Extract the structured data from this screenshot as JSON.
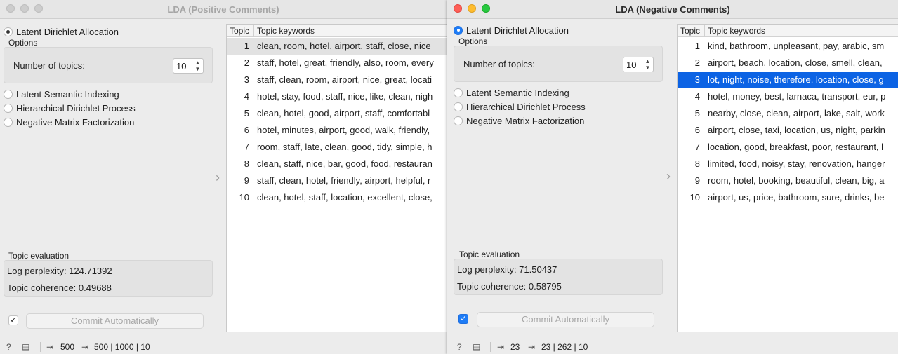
{
  "left": {
    "title": "LDA (Positive Comments)",
    "methods": {
      "lda": "Latent Dirichlet Allocation",
      "lsi": "Latent Semantic Indexing",
      "hdp": "Hierarchical Dirichlet Process",
      "nmf": "Negative Matrix Factorization"
    },
    "options_label": "Options",
    "num_topics_label": "Number of topics:",
    "num_topics_value": "10",
    "evaluation_label": "Topic evaluation",
    "log_perplexity": "Log perplexity: 124.71392",
    "topic_coherence": "Topic coherence: 0.49688",
    "commit_label": "Commit Automatically",
    "table": {
      "col_topic": "Topic",
      "col_keywords": "Topic keywords",
      "rows": [
        {
          "n": "1",
          "kw": "clean, room, hotel, airport, staff, close, nice"
        },
        {
          "n": "2",
          "kw": "staff, hotel, great, friendly, also, room, every"
        },
        {
          "n": "3",
          "kw": "staff, clean, room, airport, nice, great, locati"
        },
        {
          "n": "4",
          "kw": "hotel, stay, food, staff, nice, like, clean, nigh"
        },
        {
          "n": "5",
          "kw": "clean, hotel, good, airport, staff, comfortabl"
        },
        {
          "n": "6",
          "kw": "hotel, minutes, airport, good, walk, friendly,"
        },
        {
          "n": "7",
          "kw": "room, staff, late, clean, good, tidy, simple, h"
        },
        {
          "n": "8",
          "kw": "clean, staff, nice, bar, good, food, restauran"
        },
        {
          "n": "9",
          "kw": "staff, clean, hotel, friendly, airport, helpful, r"
        },
        {
          "n": "10",
          "kw": "clean, hotel, staff, location, excellent, close,"
        }
      ]
    },
    "status": {
      "input_count": "500",
      "output_summary": "500 | 1000 | 10"
    }
  },
  "right": {
    "title": "LDA (Negative Comments)",
    "methods": {
      "lda": "Latent Dirichlet Allocation",
      "lsi": "Latent Semantic Indexing",
      "hdp": "Hierarchical Dirichlet Process",
      "nmf": "Negative Matrix Factorization"
    },
    "options_label": "Options",
    "num_topics_label": "Number of topics:",
    "num_topics_value": "10",
    "evaluation_label": "Topic evaluation",
    "log_perplexity": "Log perplexity: 71.50437",
    "topic_coherence": "Topic coherence: 0.58795",
    "commit_label": "Commit Automatically",
    "table": {
      "col_topic": "Topic",
      "col_keywords": "Topic keywords",
      "rows": [
        {
          "n": "1",
          "kw": "kind, bathroom, unpleasant, pay, arabic, sm"
        },
        {
          "n": "2",
          "kw": "airport, beach, location, close, smell, clean,"
        },
        {
          "n": "3",
          "kw": "lot, night, noise, therefore, location, close, g"
        },
        {
          "n": "4",
          "kw": "hotel, money, best, larnaca, transport, eur, p"
        },
        {
          "n": "5",
          "kw": "nearby, close, clean, airport, lake, salt, work"
        },
        {
          "n": "6",
          "kw": "airport, close, taxi, location, us, night, parkin"
        },
        {
          "n": "7",
          "kw": "location, good, breakfast, poor, restaurant, l"
        },
        {
          "n": "8",
          "kw": "limited, food, noisy, stay, renovation, hanger"
        },
        {
          "n": "9",
          "kw": "room, hotel, booking, beautiful, clean, big, a"
        },
        {
          "n": "10",
          "kw": "airport, us, price, bathroom, sure, drinks, be"
        }
      ]
    },
    "status": {
      "input_count": "23",
      "output_summary": "23 | 262 | 10"
    }
  },
  "colors": {
    "selection_blue": "#0c63e4",
    "accent_blue": "#1e7cf6"
  }
}
